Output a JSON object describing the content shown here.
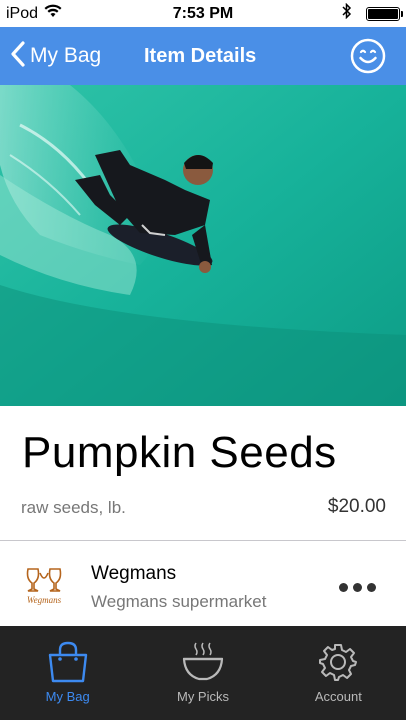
{
  "status_bar": {
    "carrier": "iPod",
    "time": "7:53 PM",
    "battery_level": 1.0
  },
  "nav": {
    "back_label": "My Bag",
    "title": "Item Details",
    "accent_color": "#4a8fe7"
  },
  "hero": {
    "image_description": "bodyboarder-riding-green-wave"
  },
  "item": {
    "name": "Pumpkin Seeds",
    "description": "raw seeds, lb.",
    "price": "$20.00"
  },
  "store": {
    "name": "Wegmans",
    "subtitle": "Wegmans supermarket",
    "logo_text": "Wegmans"
  },
  "tabs": [
    {
      "label": "My Bag",
      "icon": "bag-icon",
      "active": true
    },
    {
      "label": "My Picks",
      "icon": "bowl-icon",
      "active": false
    },
    {
      "label": "Account",
      "icon": "gear-icon",
      "active": false
    }
  ]
}
